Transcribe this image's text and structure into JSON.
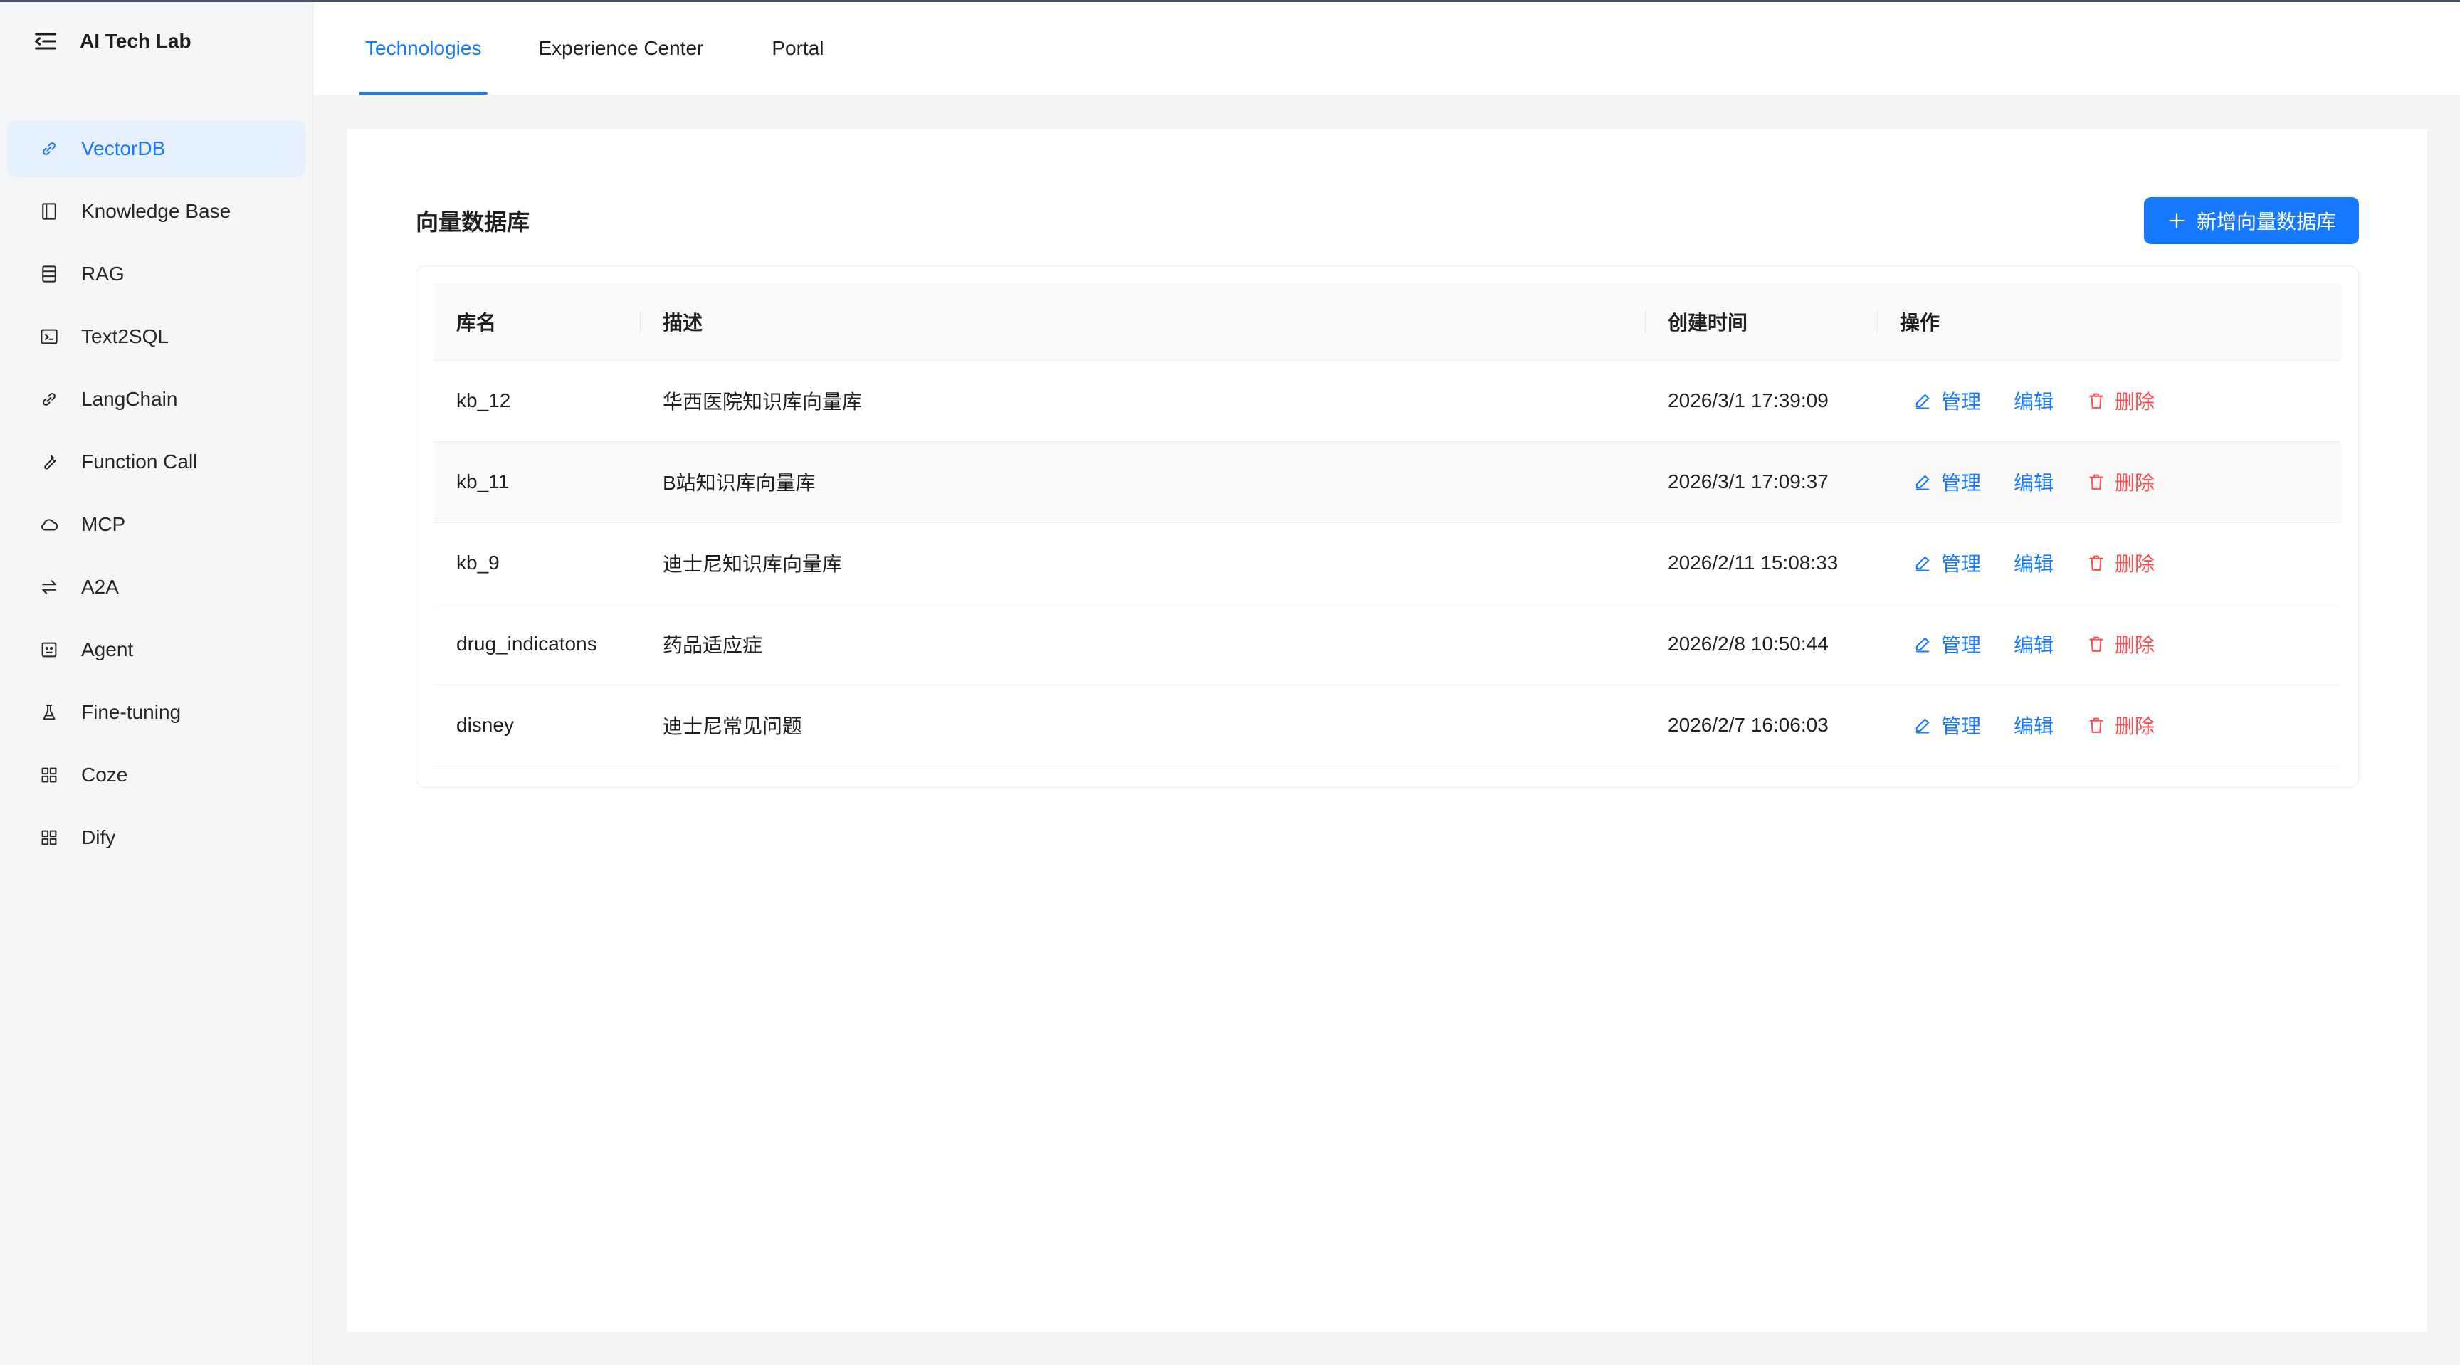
{
  "app": {
    "title": "AI Tech Lab"
  },
  "sidebar": {
    "items": [
      {
        "label": "VectorDB",
        "icon": "link-icon",
        "active": true
      },
      {
        "label": "Knowledge Base",
        "icon": "book-icon"
      },
      {
        "label": "RAG",
        "icon": "database-icon"
      },
      {
        "label": "Text2SQL",
        "icon": "terminal-icon"
      },
      {
        "label": "LangChain",
        "icon": "chain-icon"
      },
      {
        "label": "Function Call",
        "icon": "wrench-icon"
      },
      {
        "label": "MCP",
        "icon": "cloud-icon"
      },
      {
        "label": "A2A",
        "icon": "swap-icon"
      },
      {
        "label": "Agent",
        "icon": "robot-icon"
      },
      {
        "label": "Fine-tuning",
        "icon": "flask-icon"
      },
      {
        "label": "Coze",
        "icon": "apps-icon"
      },
      {
        "label": "Dify",
        "icon": "apps-icon"
      }
    ]
  },
  "tabs": [
    {
      "label": "Technologies",
      "active": true
    },
    {
      "label": "Experience Center"
    },
    {
      "label": "Portal"
    }
  ],
  "main": {
    "title": "向量数据库",
    "add_button": "新增向量数据库",
    "columns": [
      "库名",
      "描述",
      "创建时间",
      "操作"
    ],
    "rows": [
      {
        "name": "kb_12",
        "desc": "华西医院知识库向量库",
        "created": "2026/3/1 17:39:09"
      },
      {
        "name": "kb_11",
        "desc": "B站知识库向量库",
        "created": "2026/3/1 17:09:37"
      },
      {
        "name": "kb_9",
        "desc": "迪士尼知识库向量库",
        "created": "2026/2/11 15:08:33"
      },
      {
        "name": "drug_indicatons",
        "desc": "药品适应症",
        "created": "2026/2/8 10:50:44"
      },
      {
        "name": "disney",
        "desc": "迪士尼常见问题",
        "created": "2026/2/7 16:06:03"
      }
    ],
    "actions": {
      "manage": "管理",
      "edit": "编辑",
      "delete": "删除"
    }
  },
  "colors": {
    "accent": "#1677ff",
    "danger": "#ff4d4f",
    "active_bg": "#e6f0ff"
  }
}
